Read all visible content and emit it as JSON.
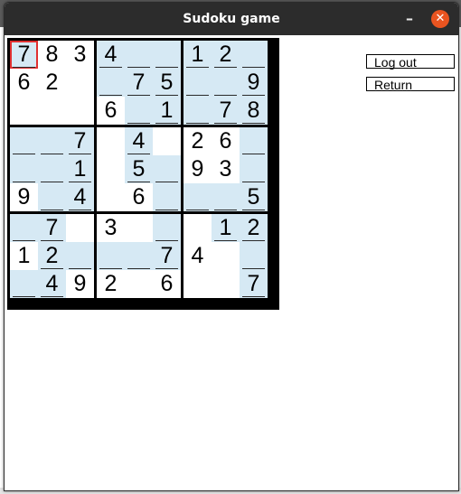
{
  "window": {
    "title": "Sudoku game"
  },
  "buttons": {
    "logout": "Log out",
    "return": "Return"
  },
  "colors": {
    "filled_cell": "#d6e9f4",
    "selected_border": "#e03030",
    "close_button": "#e95420"
  },
  "selected_cell": {
    "row": 0,
    "col": 0
  },
  "board": [
    [
      "7",
      "8",
      "3",
      "4",
      "",
      "",
      "1",
      "2",
      ""
    ],
    [
      "6",
      "2",
      "",
      "",
      "7",
      "5",
      "",
      "",
      "9"
    ],
    [
      "",
      "",
      "",
      "6",
      "",
      "1",
      "",
      "7",
      "8"
    ],
    [
      "",
      "",
      "7",
      "",
      "4",
      "",
      "2",
      "6",
      ""
    ],
    [
      "",
      "",
      "1",
      "",
      "5",
      "",
      "9",
      "3",
      ""
    ],
    [
      "9",
      "",
      "4",
      "",
      "6",
      "",
      "",
      "",
      "5"
    ],
    [
      "",
      "7",
      "",
      "3",
      "",
      "",
      "",
      "1",
      "2"
    ],
    [
      "1",
      "2",
      "",
      "",
      "",
      "7",
      "4",
      "",
      ""
    ],
    [
      "",
      "4",
      "9",
      "2",
      "",
      "6",
      "",
      "",
      "7"
    ]
  ],
  "filled": [
    [
      1,
      0,
      0,
      1,
      1,
      1,
      1,
      1,
      1
    ],
    [
      0,
      0,
      0,
      1,
      1,
      1,
      1,
      1,
      1
    ],
    [
      0,
      0,
      0,
      0,
      1,
      1,
      1,
      1,
      1
    ],
    [
      1,
      1,
      1,
      0,
      1,
      0,
      0,
      0,
      1
    ],
    [
      1,
      1,
      1,
      0,
      1,
      1,
      0,
      0,
      1
    ],
    [
      0,
      1,
      1,
      0,
      0,
      1,
      1,
      1,
      1
    ],
    [
      1,
      1,
      0,
      0,
      0,
      1,
      0,
      1,
      1
    ],
    [
      0,
      1,
      1,
      1,
      1,
      1,
      0,
      0,
      1
    ],
    [
      1,
      1,
      0,
      0,
      0,
      0,
      0,
      0,
      1
    ]
  ]
}
